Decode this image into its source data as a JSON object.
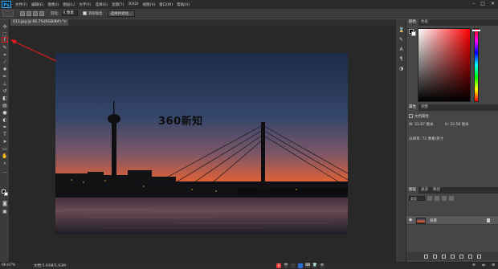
{
  "app": {
    "logo_text": "Ps"
  },
  "menu": {
    "items": [
      "文件(F)",
      "编辑(E)",
      "图像(I)",
      "图层(L)",
      "文字(Y)",
      "选择(S)",
      "滤镜(T)",
      "3D(D)",
      "视图(V)",
      "窗口(W)",
      "帮助(H)"
    ],
    "window_controls": [
      "–",
      "□",
      "✕"
    ]
  },
  "options_bar": {
    "feather_label": "羽化:",
    "feather_value": "0 像素",
    "antialias_label": "消除锯齿",
    "select_mask_button": "选择并遮住..."
  },
  "document": {
    "tab_title": "013.jpg @ 66.7%(RGB/8#) *",
    "tab_close": "×",
    "overlay_text": "360新知"
  },
  "statusbar": {
    "zoom": "66.67%",
    "doc_info": "文档:5.93M/5.93M",
    "ime": [
      "S",
      "中",
      "·",
      "🎤",
      "⌨",
      "👕",
      "⚙"
    ],
    "tray": [
      "⊕",
      "中",
      "⊞"
    ]
  },
  "right_panel": {
    "color_tabs": [
      "颜色",
      "色板"
    ],
    "properties_tabs": [
      "属性",
      "调整"
    ],
    "properties_title": "文档属性",
    "properties_w": "W: 33.87 厘米",
    "properties_h": "H: 22.58 厘米",
    "properties_res": "分辨率: 72 像素/英寸",
    "layers_tabs": [
      "图层",
      "通道",
      "路径"
    ],
    "layers_kind": "类型",
    "layer_name": "背景"
  },
  "colors": {
    "accent_red": "#e31c1c",
    "panel_bg": "#464646",
    "workspace_bg": "#282828"
  },
  "icons": {
    "tools": [
      "move-icon",
      "marquee-icon",
      "lasso-icon",
      "quick-select-icon",
      "crop-icon",
      "eyedropper-icon",
      "healing-icon",
      "brush-icon",
      "stamp-icon",
      "history-brush-icon",
      "eraser-icon",
      "gradient-icon",
      "blur-icon",
      "dodge-icon",
      "pen-icon",
      "type-icon",
      "path-select-icon",
      "rectangle-icon",
      "hand-icon",
      "zoom-icon",
      "more-icon"
    ]
  }
}
